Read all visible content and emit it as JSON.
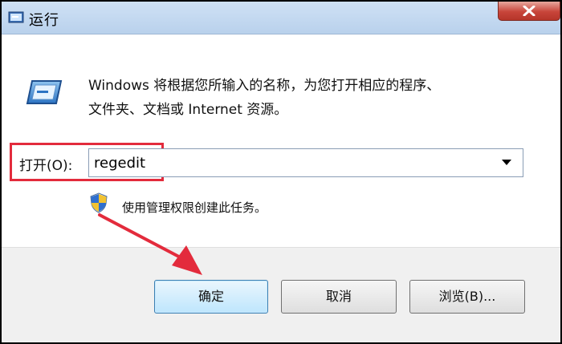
{
  "window": {
    "title": "运行",
    "close_icon": "close-icon"
  },
  "description": {
    "line1": "Windows 将根据您所输入的名称，为您打开相应的程序、",
    "line2": "文件夹、文档或 Internet 资源。"
  },
  "open_field": {
    "label": "打开(O):",
    "value": "regedit"
  },
  "admin_note": {
    "text": "使用管理权限创建此任务。"
  },
  "buttons": {
    "ok": "确定",
    "cancel": "取消",
    "browse": "浏览(B)..."
  },
  "colors": {
    "annotation_red": "#e32b3c",
    "title_bar": "#c4d9f1",
    "close_red": "#c8453a"
  },
  "icons": [
    "run-app-icon",
    "run-dialog-icon",
    "uac-shield-icon",
    "dropdown-arrow-icon",
    "close-icon"
  ]
}
